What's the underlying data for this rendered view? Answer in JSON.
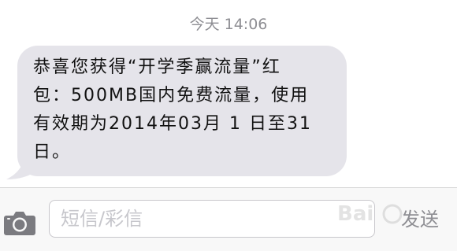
{
  "thread": {
    "timestamp": "今天 14:06"
  },
  "message": {
    "text": "恭喜您获得“开学季赢流量”红\n包：500MB国内免费流量，使用\n有效期为2014年03月 1 日至31\n日。"
  },
  "composer": {
    "placeholder": "短信/彩信",
    "value": "",
    "send_label": "发送",
    "camera_icon": "camera-icon"
  },
  "watermark": {
    "text": "Bai"
  },
  "colors": {
    "bubble": "#e5e4ea",
    "timestamp": "#8e8e93",
    "composer_bg": "#f8f8f8",
    "send_disabled": "#8e8e93"
  }
}
